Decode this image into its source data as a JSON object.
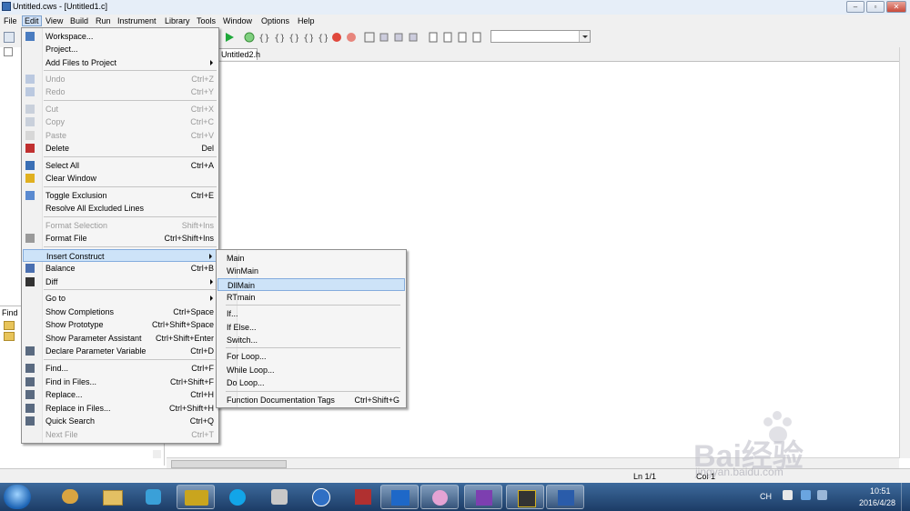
{
  "window": {
    "title": "Untitled.cws - [Untitled1.c]"
  },
  "menubar": [
    "File",
    "Edit",
    "View",
    "Build",
    "Run",
    "Instrument",
    "Library",
    "Tools",
    "Window",
    "Options",
    "Help"
  ],
  "editor": {
    "tab_label": "Untitled2.h"
  },
  "find_panel": {
    "label": "Find"
  },
  "edit_menu": [
    {
      "label": "Workspace...",
      "shortcut": "",
      "disabled": false,
      "submenu": false
    },
    {
      "label": "Project...",
      "shortcut": "",
      "disabled": false,
      "submenu": false
    },
    {
      "label": "Add Files to Project",
      "shortcut": "",
      "disabled": false,
      "submenu": true
    },
    {
      "label": "Undo",
      "shortcut": "Ctrl+Z",
      "disabled": true,
      "submenu": false
    },
    {
      "label": "Redo",
      "shortcut": "Ctrl+Y",
      "disabled": true,
      "submenu": false
    },
    {
      "label": "Cut",
      "shortcut": "Ctrl+X",
      "disabled": true,
      "submenu": false
    },
    {
      "label": "Copy",
      "shortcut": "Ctrl+C",
      "disabled": true,
      "submenu": false
    },
    {
      "label": "Paste",
      "shortcut": "Ctrl+V",
      "disabled": true,
      "submenu": false
    },
    {
      "label": "Delete",
      "shortcut": "Del",
      "disabled": false,
      "submenu": false
    },
    {
      "label": "Select All",
      "shortcut": "Ctrl+A",
      "disabled": false,
      "submenu": false
    },
    {
      "label": "Clear Window",
      "shortcut": "",
      "disabled": false,
      "submenu": false
    },
    {
      "label": "Toggle Exclusion",
      "shortcut": "Ctrl+E",
      "disabled": false,
      "submenu": false
    },
    {
      "label": "Resolve All Excluded Lines",
      "shortcut": "",
      "disabled": false,
      "submenu": false
    },
    {
      "label": "Format Selection",
      "shortcut": "Shift+Ins",
      "disabled": true,
      "submenu": false
    },
    {
      "label": "Format File",
      "shortcut": "Ctrl+Shift+Ins",
      "disabled": false,
      "submenu": false
    },
    {
      "label": "Insert Construct",
      "shortcut": "",
      "disabled": false,
      "submenu": true,
      "highlighted": true
    },
    {
      "label": "Balance",
      "shortcut": "Ctrl+B",
      "disabled": false,
      "submenu": false
    },
    {
      "label": "Diff",
      "shortcut": "",
      "disabled": false,
      "submenu": true
    },
    {
      "label": "Go to",
      "shortcut": "",
      "disabled": false,
      "submenu": true
    },
    {
      "label": "Show Completions",
      "shortcut": "Ctrl+Space",
      "disabled": false,
      "submenu": false
    },
    {
      "label": "Show Prototype",
      "shortcut": "Ctrl+Shift+Space",
      "disabled": false,
      "submenu": false
    },
    {
      "label": "Show Parameter Assistant",
      "shortcut": "Ctrl+Shift+Enter",
      "disabled": false,
      "submenu": false
    },
    {
      "label": "Declare Parameter Variable",
      "shortcut": "Ctrl+D",
      "disabled": false,
      "submenu": false
    },
    {
      "label": "Find...",
      "shortcut": "Ctrl+F",
      "disabled": false,
      "submenu": false
    },
    {
      "label": "Find in Files...",
      "shortcut": "Ctrl+Shift+F",
      "disabled": false,
      "submenu": false
    },
    {
      "label": "Replace...",
      "shortcut": "Ctrl+H",
      "disabled": false,
      "submenu": false
    },
    {
      "label": "Replace in Files...",
      "shortcut": "Ctrl+Shift+H",
      "disabled": false,
      "submenu": false
    },
    {
      "label": "Quick Search",
      "shortcut": "Ctrl+Q",
      "disabled": false,
      "submenu": false
    },
    {
      "label": "Next File",
      "shortcut": "Ctrl+T",
      "disabled": true,
      "submenu": false
    }
  ],
  "insert_construct_menu": [
    {
      "label": "Main",
      "shortcut": ""
    },
    {
      "label": "WinMain",
      "shortcut": ""
    },
    {
      "label": "DllMain",
      "shortcut": "",
      "highlighted": true
    },
    {
      "label": "RTmain",
      "shortcut": ""
    },
    {
      "label": "If...",
      "shortcut": ""
    },
    {
      "label": "If Else...",
      "shortcut": ""
    },
    {
      "label": "Switch...",
      "shortcut": ""
    },
    {
      "label": "For Loop...",
      "shortcut": ""
    },
    {
      "label": "While Loop...",
      "shortcut": ""
    },
    {
      "label": "Do Loop...",
      "shortcut": ""
    },
    {
      "label": "Function Documentation Tags",
      "shortcut": "Ctrl+Shift+G"
    }
  ],
  "statusbar": {
    "line": "Ln 1/1",
    "col": "Col 1"
  },
  "taskbar": {
    "tray_lang": "CH",
    "time": "10:51",
    "date": "2016/4/28"
  },
  "watermark": {
    "text": "Bai经验",
    "url": "jingyan.baidu.com"
  },
  "colors": {
    "menu_highlight": "#cde3f8",
    "taskbar": "#1c3c66",
    "run_button": "#1ea83a"
  }
}
